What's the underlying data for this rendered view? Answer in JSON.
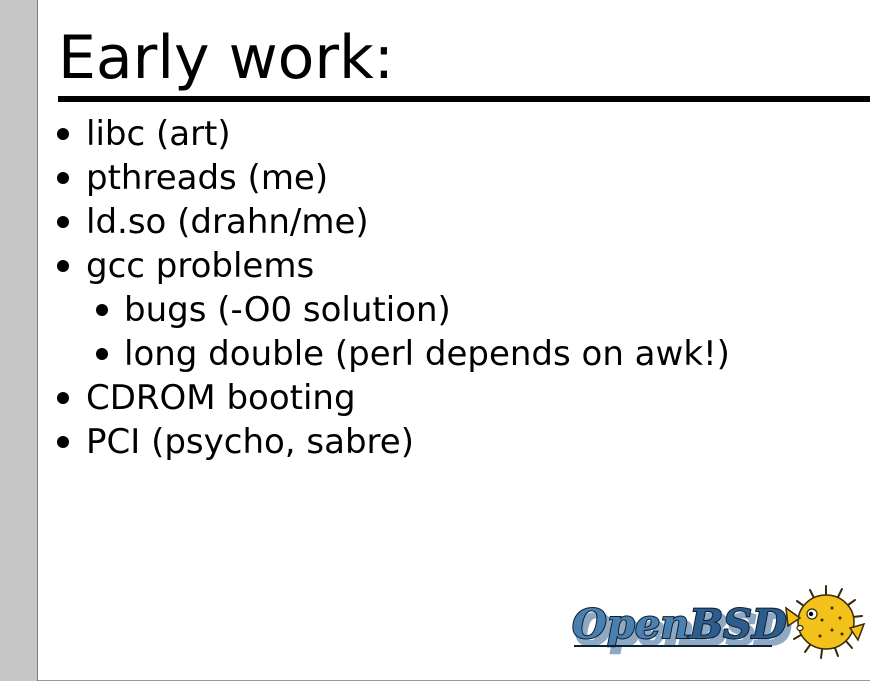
{
  "slide": {
    "title": "Early work:",
    "bullets": [
      {
        "level": 1,
        "text": "libc (art)"
      },
      {
        "level": 1,
        "text": "pthreads (me)"
      },
      {
        "level": 1,
        "text": "ld.so (drahn/me)"
      },
      {
        "level": 1,
        "text": "gcc problems"
      },
      {
        "level": 2,
        "text": "bugs (-O0 solution)"
      },
      {
        "level": 2,
        "text": "long double (perl depends on awk!)"
      },
      {
        "level": 1,
        "text": "CDROM booting"
      },
      {
        "level": 1,
        "text": "PCI (psycho, sabre)"
      }
    ],
    "logo": {
      "text_open": "Open",
      "text_bsd": "BSD",
      "mascot_icon": "pufferfish-icon",
      "colors": {
        "open_fill": "#4a7fb0",
        "bsd_fill": "#2c5d8c",
        "outline": "#0d1f33",
        "shadow": "#8fa9c4",
        "fish_body": "#f2c21a",
        "fish_spines": "#3a2a05"
      }
    }
  }
}
